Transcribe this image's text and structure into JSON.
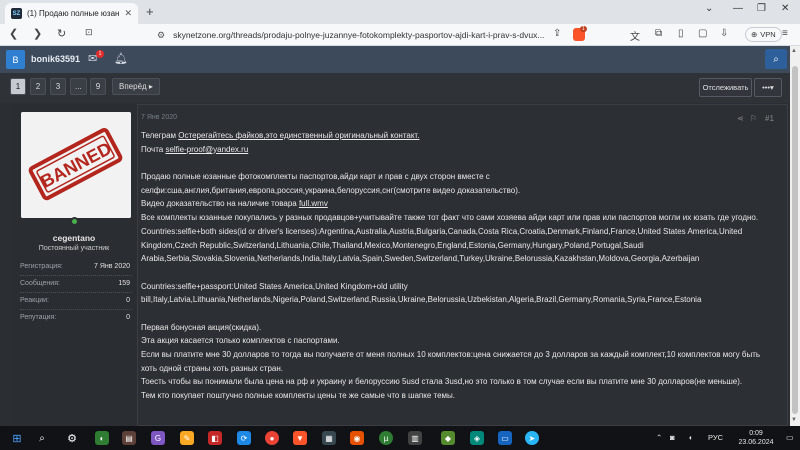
{
  "browser": {
    "tab_title": "(1) Продаю полные юзанные ф",
    "favicon_text": "SZ",
    "url": "skynetzone.org/threads/prodaju-polnye-juzannye-fotokomplekty-pasportov-ajdi-kart-i-prav-s-dvux...",
    "vpn_label": "VPN",
    "brave_badge": "1"
  },
  "forum_header": {
    "avatar_letter": "B",
    "username": "bonik63591",
    "inbox_badge": "1"
  },
  "pagination": {
    "pages": [
      "1",
      "2",
      "3",
      "...",
      "9"
    ],
    "active_page": "1",
    "next_label": "Вперёд ▸",
    "watch_label": "Отслеживать",
    "more_label": "•••▾"
  },
  "post": {
    "date": "7 Янв 2020",
    "number": "#1",
    "avatar_stamp": "BANNED",
    "username": "cegentano",
    "user_title": "Постоянный участник",
    "stats": [
      {
        "key": "Регистрация:",
        "value": "7 Янв 2020"
      },
      {
        "key": "Сообщения:",
        "value": "159"
      },
      {
        "key": "Реакции:",
        "value": "0"
      },
      {
        "key": "Репутация:",
        "value": "0"
      }
    ],
    "lines": {
      "l1_prefix": "Телеграм ",
      "l1_link": "Остерегайтесь файков,это единственный оригинальный контакт.",
      "l2_prefix": "Почта ",
      "l2_link": "selfie-proof@yandex.ru",
      "l3": "Продаю полные юзанные фотокомплекты паспортов,айди карт и прав с двух сторон вместе с",
      "l4": "селфи:сша,англия,британия,европа,россия,украина,белоруссия,снг(смотрите видео доказательство).",
      "l5_prefix": "Видео доказательство на наличие товара ",
      "l5_link": "full.wmv",
      "l6": "Все комплекты юзанные покупались у разных продавцов+учитывайте также тот факт что сами хозяева айди карт или прав или паспортов могли их юзать где угодно.",
      "l7": "Countries:selfie+both sides(id or driver's licenses):Argentina,Australia,Austria,Bulgaria,Canada,Costa Rica,Croatia,Denmark,Finland,France,United States America,United",
      "l8": "Kingdom,Czech Republic,Switzerland,Lithuania,Chile,Thailand,Mexico,Montenegro,England,Estonia,Germany,Hungary,Poland,Portugal,Saudi",
      "l9": "Arabia,Serbia,Slovakia,Slovenia,Netherlands,India,Italy,Latvia,Spain,Sweden,Switzerland,Turkey,Ukraine,Belorussia,Kazakhstan,Moldova,Georgia,Azerbaijan",
      "l10": "Countries:selfie+passport:United States America,United Kingdom+old utility",
      "l11": "bill,Italy,Latvia,Lithuania,Netherlands,Nigeria,Poland,Switzerland,Russia,Ukraine,Belorussia,Uzbekistan,Algeria,Brazil,Germany,Romania,Syria,France,Estonia",
      "l12": "Первая бонусная акция(скидка).",
      "l13": "Эта акция касается только комплектов с паспортами.",
      "l14": "Если вы платите мне 30 долларов то тогда вы получаете от меня полных 10 комплектов:цена снижается до 3 долларов за каждый комплект,10 комплектов могу быть",
      "l15": "хоть одной страны хоть разных стран.",
      "l16": "Тоесть чтобы вы понимали была цена на рф и украину и белоруссию 5usd стала 3usd,но это только в том случае если вы платите мне 30 долларов(не меньше).",
      "l17": "Тем кто покупает поштучно полные комплекты цены те же самые что в шапке темы."
    }
  },
  "taskbar": {
    "lang": "РУС",
    "time": "0:09",
    "date": "23.06.2024"
  },
  "colors": {
    "page_bg": "#2b2e33",
    "header_bg": "#3d4a5c",
    "banned_red": "#c0392b",
    "online_green": "#4caf50"
  }
}
